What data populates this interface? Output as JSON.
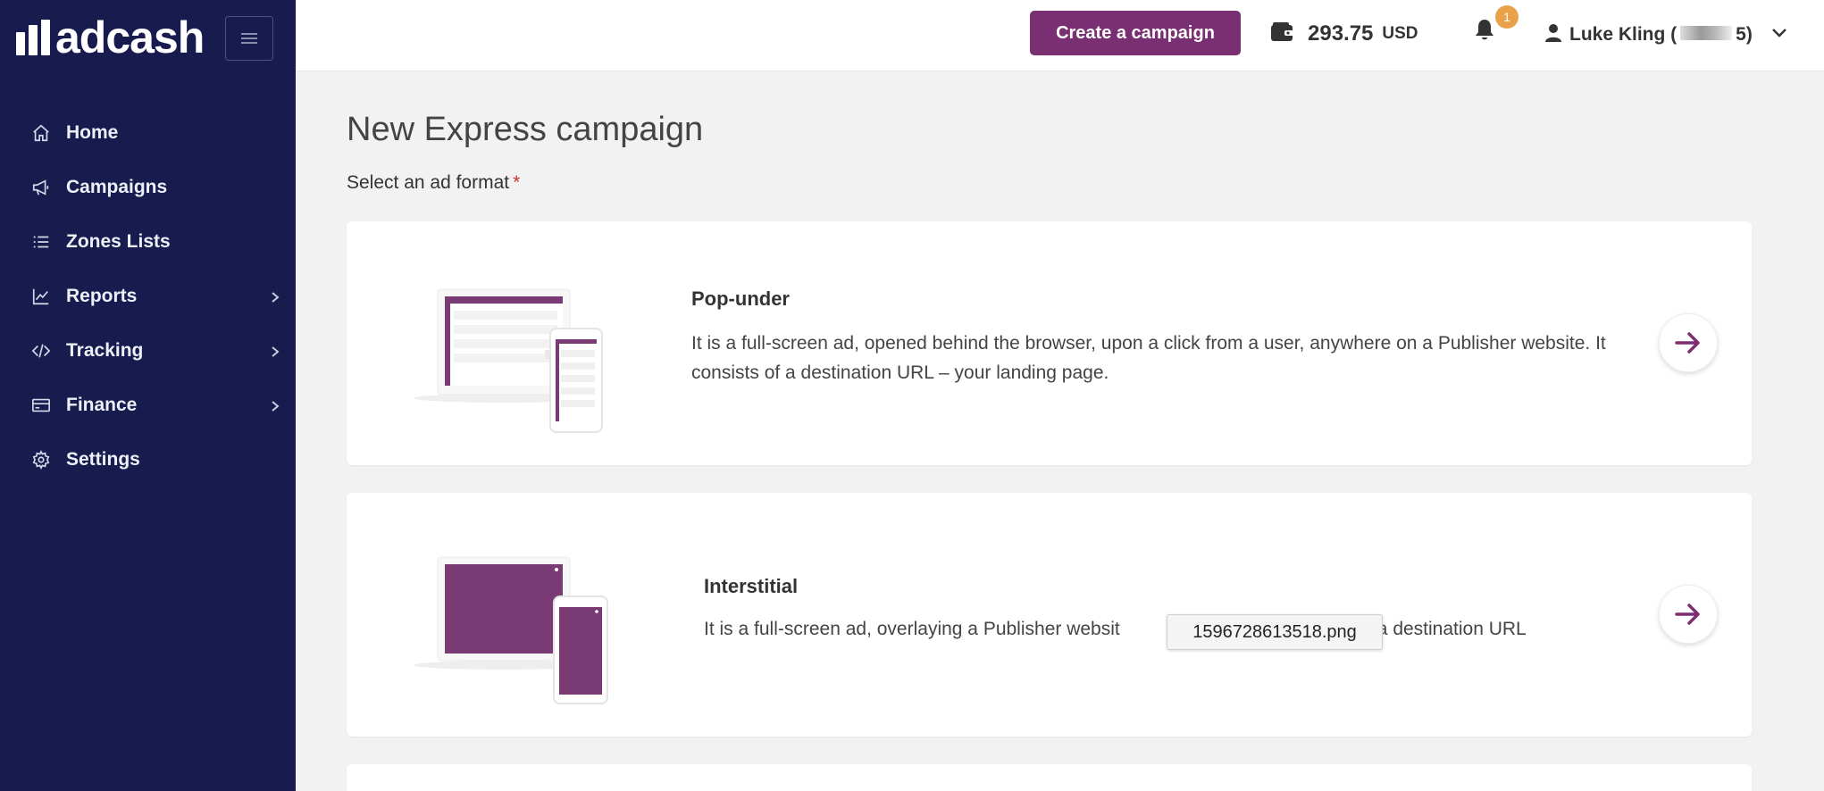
{
  "brand": {
    "logo_text": "adcash"
  },
  "sidebar": {
    "items": [
      {
        "label": "Home",
        "icon": "home-icon",
        "has_submenu": false
      },
      {
        "label": "Campaigns",
        "icon": "megaphone-icon",
        "has_submenu": false
      },
      {
        "label": "Zones Lists",
        "icon": "list-icon",
        "has_submenu": false
      },
      {
        "label": "Reports",
        "icon": "chart-icon",
        "has_submenu": true
      },
      {
        "label": "Tracking",
        "icon": "code-icon",
        "has_submenu": true
      },
      {
        "label": "Finance",
        "icon": "card-icon",
        "has_submenu": true
      },
      {
        "label": "Settings",
        "icon": "gear-icon",
        "has_submenu": false
      }
    ]
  },
  "header": {
    "create_button": "Create a campaign",
    "balance": {
      "amount": "293.75",
      "currency": "USD"
    },
    "notifications_count": "1",
    "user": {
      "name_start": "Luke Kling (",
      "name_end": "5)"
    }
  },
  "main": {
    "title": "New Express campaign",
    "select_label": "Select an ad format",
    "required_mark": "*",
    "formats": [
      {
        "title": "Pop-under",
        "description": "It is a full-screen ad, opened behind the browser, upon a click from a user, anywhere on a Publisher website. It consists of a destination URL – your landing page."
      },
      {
        "title": "Interstitial",
        "description": "It is a full-screen ad, overlaying a Publisher websit",
        "description_tail": "ge and a destination URL"
      }
    ]
  },
  "tooltip": {
    "text": "1596728613518.png"
  },
  "colors": {
    "sidebar_bg": "#171b4d",
    "accent": "#7b2f73",
    "badge": "#e9a24a",
    "page_bg": "#f2f2f2"
  }
}
